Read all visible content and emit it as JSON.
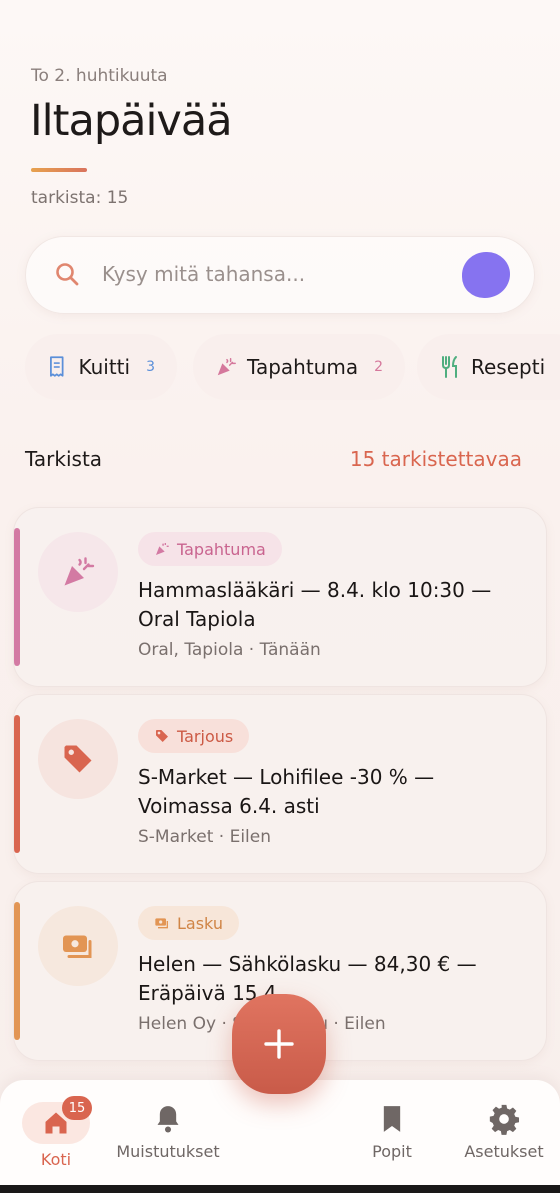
{
  "header": {
    "date": "To 2. huhtikuuta",
    "greeting": "Iltapäivää",
    "check_count": "tarkista: 15"
  },
  "search": {
    "placeholder": "Kysy mitä tahansa...",
    "icon": "search-icon",
    "voice_color": "#8673f0"
  },
  "chips": [
    {
      "label": "Kuitti",
      "count": "3",
      "icon": "receipt-icon",
      "color": "#5b8fd9"
    },
    {
      "label": "Tapahtuma",
      "count": "2",
      "icon": "party-popper-icon",
      "color": "#d5789c"
    },
    {
      "label": "Resepti",
      "count": "",
      "icon": "utensils-icon",
      "color": "#4fae7f"
    }
  ],
  "section": {
    "title": "Tarkista",
    "link": "15 tarkistettavaa"
  },
  "cards": [
    {
      "tag": "Tapahtuma",
      "icon": "party-popper-icon",
      "title": "Hammaslääkäri — 8.4. klo 10:30 — Oral Tapiola",
      "meta": "Oral, Tapiola · Tänään",
      "color": "#d37aa3"
    },
    {
      "tag": "Tarjous",
      "icon": "price-tag-icon",
      "title": "S-Market — Lohifilee -30 % — Voimassa 6.4. asti",
      "meta": "S-Market · Eilen",
      "color": "#d9654f"
    },
    {
      "tag": "Lasku",
      "icon": "bill-icon",
      "title": "Helen — Sähkölasku — 84,30 € — Eräpäivä 15.4.",
      "meta": "Helen Oy · Sähkölasku · Eilen",
      "color": "#e29554"
    }
  ],
  "fab": {
    "icon": "plus-icon"
  },
  "nav": {
    "home": {
      "label": "Koti",
      "badge": "15",
      "icon": "home-icon"
    },
    "reminders": {
      "label": "Muistutukset",
      "icon": "bell-icon"
    },
    "lists": {
      "label": "Popit",
      "icon": "bookmark-icon"
    },
    "settings": {
      "label": "Asetukset",
      "icon": "gear-icon"
    }
  },
  "colors": {
    "accent": "#d9664f",
    "background": "#fbf5f2"
  }
}
